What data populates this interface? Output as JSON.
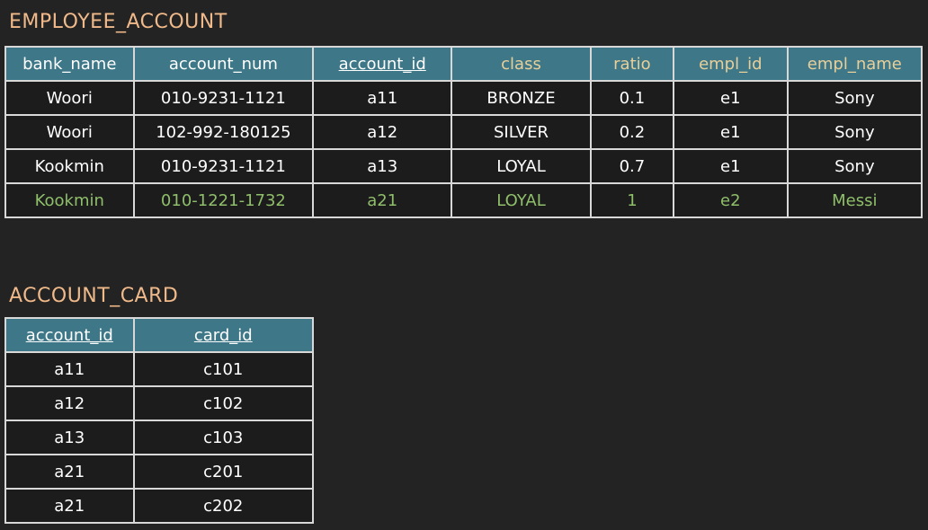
{
  "employee_account": {
    "title": "EMPLOYEE_ACCOUNT",
    "columns": [
      {
        "label": "bank_name",
        "key": false,
        "tan": false
      },
      {
        "label": "account_num",
        "key": false,
        "tan": false
      },
      {
        "label": "account_id",
        "key": true,
        "tan": false
      },
      {
        "label": "class",
        "key": false,
        "tan": true
      },
      {
        "label": "ratio",
        "key": false,
        "tan": true
      },
      {
        "label": "empl_id",
        "key": false,
        "tan": true
      },
      {
        "label": "empl_name",
        "key": false,
        "tan": true
      }
    ],
    "rows": [
      {
        "cells": [
          "Woori",
          "010-9231-1121",
          "a11",
          "BRONZE",
          "0.1",
          "e1",
          "Sony"
        ],
        "highlight": false
      },
      {
        "cells": [
          "Woori",
          "102-992-180125",
          "a12",
          "SILVER",
          "0.2",
          "e1",
          "Sony"
        ],
        "highlight": false
      },
      {
        "cells": [
          "Kookmin",
          "010-9231-1121",
          "a13",
          "LOYAL",
          "0.7",
          "e1",
          "Sony"
        ],
        "highlight": false
      },
      {
        "cells": [
          "Kookmin",
          "010-1221-1732",
          "a21",
          "LOYAL",
          "1",
          "e2",
          "Messi"
        ],
        "highlight": true
      }
    ]
  },
  "account_card": {
    "title": "ACCOUNT_CARD",
    "columns": [
      {
        "label": "account_id",
        "key": true,
        "tan": false
      },
      {
        "label": "card_id",
        "key": true,
        "tan": false
      }
    ],
    "rows": [
      {
        "cells": [
          "a11",
          "c101"
        ],
        "highlight": false
      },
      {
        "cells": [
          "a12",
          "c102"
        ],
        "highlight": false
      },
      {
        "cells": [
          "a13",
          "c103"
        ],
        "highlight": false
      },
      {
        "cells": [
          "a21",
          "c201"
        ],
        "highlight": false
      },
      {
        "cells": [
          "a21",
          "c202"
        ],
        "highlight": false
      }
    ]
  },
  "colors": {
    "title": "#f0b98a",
    "header_bg": "#3e7888",
    "header_tan": "#e8cf9a",
    "highlight": "#8fbf6a",
    "background": "#232323"
  }
}
